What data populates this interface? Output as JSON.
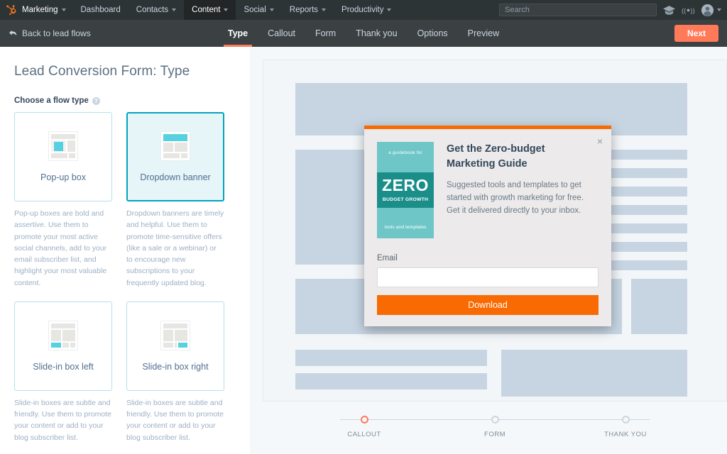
{
  "topnav": {
    "brand": "Marketing",
    "items": [
      {
        "label": "Dashboard",
        "caret": false,
        "active": false
      },
      {
        "label": "Contacts",
        "caret": true,
        "active": false
      },
      {
        "label": "Content",
        "caret": true,
        "active": true
      },
      {
        "label": "Social",
        "caret": true,
        "active": false
      },
      {
        "label": "Reports",
        "caret": true,
        "active": false
      },
      {
        "label": "Productivity",
        "caret": true,
        "active": false
      }
    ],
    "search_placeholder": "Search",
    "search_value": "",
    "icons": [
      "graduation-cap-icon",
      "broadcast-icon",
      "avatar"
    ]
  },
  "subnav": {
    "back_label": "Back to lead flows",
    "tabs": [
      {
        "label": "Type",
        "active": true
      },
      {
        "label": "Callout",
        "active": false
      },
      {
        "label": "Form",
        "active": false
      },
      {
        "label": "Thank you",
        "active": false
      },
      {
        "label": "Options",
        "active": false
      },
      {
        "label": "Preview",
        "active": false
      }
    ],
    "next_label": "Next"
  },
  "left": {
    "page_title": "Lead Conversion Form: Type",
    "choose_label": "Choose a flow type",
    "help_icon_char": "?",
    "cards": [
      {
        "label": "Pop-up box",
        "selected": false,
        "desc": "Pop-up boxes are bold and assertive. Use them to promote your most active social channels, add to your email subscriber list, and highlight your most valuable content.",
        "icon": "popup-box-icon"
      },
      {
        "label": "Dropdown banner",
        "selected": true,
        "desc": "Dropdown banners are timely and helpful. Use them to promote time-sensitive offers (like a sale or a webinar) or to encourage new subscriptions to your frequently updated blog.",
        "icon": "dropdown-banner-icon"
      },
      {
        "label": "Slide-in box left",
        "selected": false,
        "desc": "Slide-in boxes are subtle and friendly. Use them to promote your content or add to your blog subscriber list.",
        "icon": "slide-in-left-icon"
      },
      {
        "label": "Slide-in box right",
        "selected": false,
        "desc": "Slide-in boxes are subtle and friendly. Use them to promote your content or add to your blog subscriber list.",
        "icon": "slide-in-right-icon"
      }
    ]
  },
  "modal": {
    "close_char": "×",
    "heading": "Get the Zero-budget Marketing Guide",
    "description": "Suggested tools and templates to get started with growth marketing for free. Get it delivered directly to your inbox.",
    "ebook": {
      "top": "a guidebook for",
      "title": "ZERO",
      "subtitle": "BUDGET GROWTH",
      "bottom": "tools and templates"
    },
    "email_label": "Email",
    "email_value": "",
    "email_placeholder": "",
    "submit_label": "Download"
  },
  "stepper": {
    "steps": [
      {
        "label": "CALLOUT",
        "active": true
      },
      {
        "label": "FORM",
        "active": false
      },
      {
        "label": "THANK YOU",
        "active": false
      }
    ]
  },
  "colors": {
    "accent_orange": "#ff7a59",
    "cta_orange": "#f96a02",
    "selected_teal": "#00a4bd",
    "selected_bg": "#e5f5f8",
    "nav_dark": "#2d3436",
    "subnav_dark": "#3b4043",
    "wireframe_block": "#c7d5e3",
    "ebook_light_teal": "#6ec6c6",
    "ebook_dark_teal": "#1b8e8a"
  }
}
